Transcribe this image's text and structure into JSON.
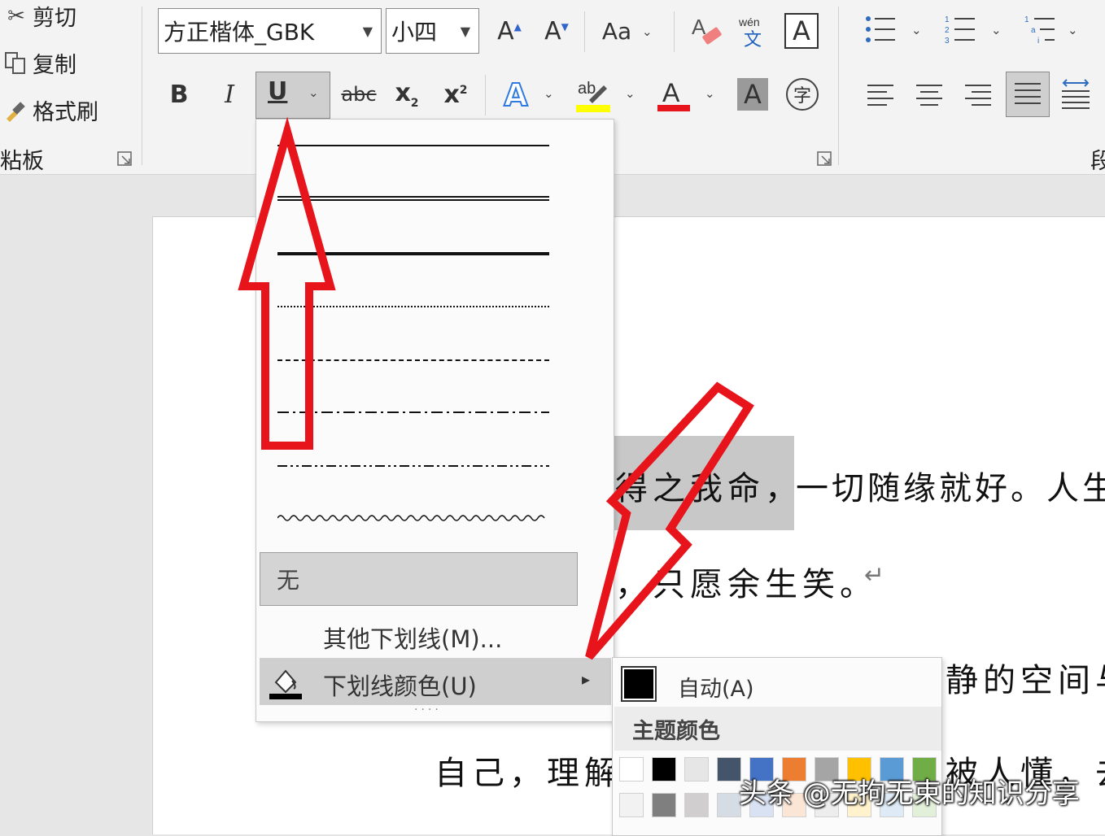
{
  "clipboard": {
    "cut_label": "剪切",
    "copy_label": "复制",
    "format_painter_label": "格式刷",
    "group_label": "粘板"
  },
  "font": {
    "name": "方正楷体_GBK",
    "size": "小四"
  },
  "format_buttons": {
    "bold": "B",
    "italic": "I",
    "underline": "U",
    "strike": "abc",
    "change_case": "Aa"
  },
  "paragraph": {
    "group_label_partial": "段"
  },
  "underline_menu": {
    "none_label": "无",
    "more_label": "其他下划线(M)...",
    "color_label": "下划线颜色(U)"
  },
  "color_submenu": {
    "auto_label": "自动(A)",
    "theme_header": "主题颜色",
    "theme_row1": [
      "#ffffff",
      "#000000",
      "#e7e6e6",
      "#44546a",
      "#4472c4",
      "#ed7d31",
      "#a5a5a5",
      "#ffc000",
      "#5b9bd5",
      "#70ad47"
    ],
    "theme_row2": [
      "#f2f2f2",
      "#7f7f7f",
      "#d0cece",
      "#d6dce4",
      "#d9e2f3",
      "#fbe5d5",
      "#ededed",
      "#fff2cc",
      "#deebf6",
      "#e2efd9"
    ]
  },
  "document": {
    "line1_highlight": "得之我命，",
    "line1_rest": "一切随缘就好。人生",
    "line2": "，只愿余生笑。",
    "line3_left": "自己，理解",
    "line3_right": "静的空间与",
    "line4_right": "被人懂，去",
    "pilcrow": "↵"
  },
  "watermark": "头条 @无拘无束的知识分享",
  "colors": {
    "arrow_red": "#e8141c",
    "highlight_yellow": "#ffff00",
    "font_color_red": "#e8141c"
  }
}
